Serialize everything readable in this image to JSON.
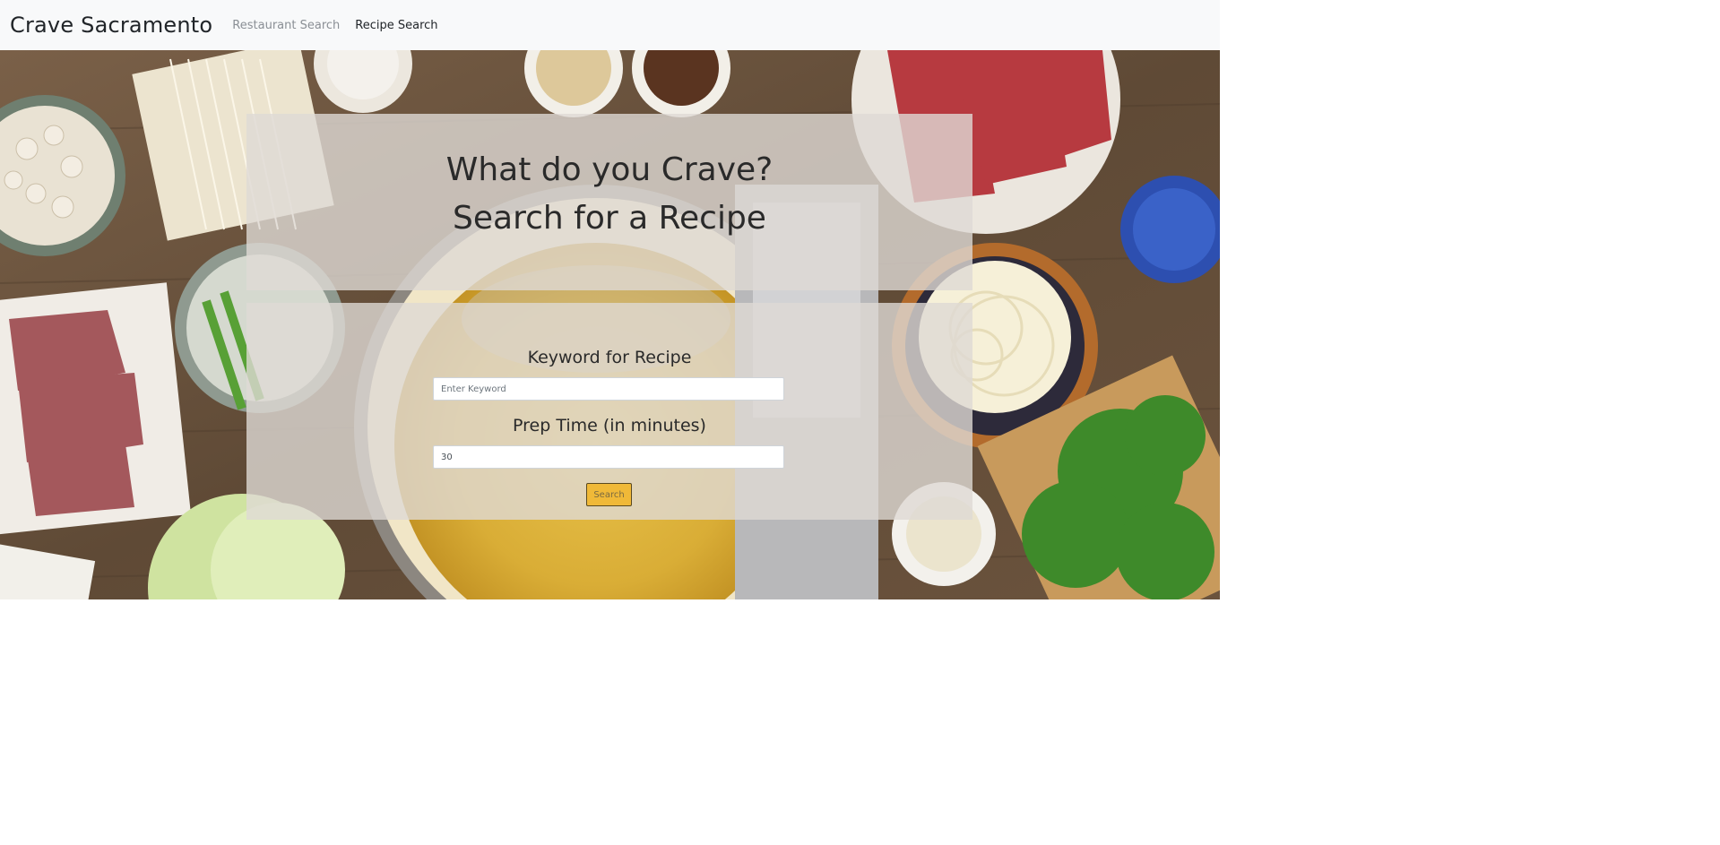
{
  "navbar": {
    "brand": "Crave Sacramento",
    "links": [
      {
        "label": "Restaurant Search",
        "active": false
      },
      {
        "label": "Recipe Search",
        "active": true
      }
    ]
  },
  "hero": {
    "heading_line1": "What do you Crave?",
    "heading_line2": "Search for a Recipe"
  },
  "form": {
    "keyword_label": "Keyword for Recipe",
    "keyword_placeholder": "Enter Keyword",
    "keyword_value": "",
    "prep_label": "Prep Time (in minutes)",
    "prep_value": "30",
    "search_label": "Search"
  },
  "colors": {
    "navbar_bg": "#f8f9fa",
    "search_button": "#f0b938",
    "panel_overlay": "#dedad4"
  }
}
